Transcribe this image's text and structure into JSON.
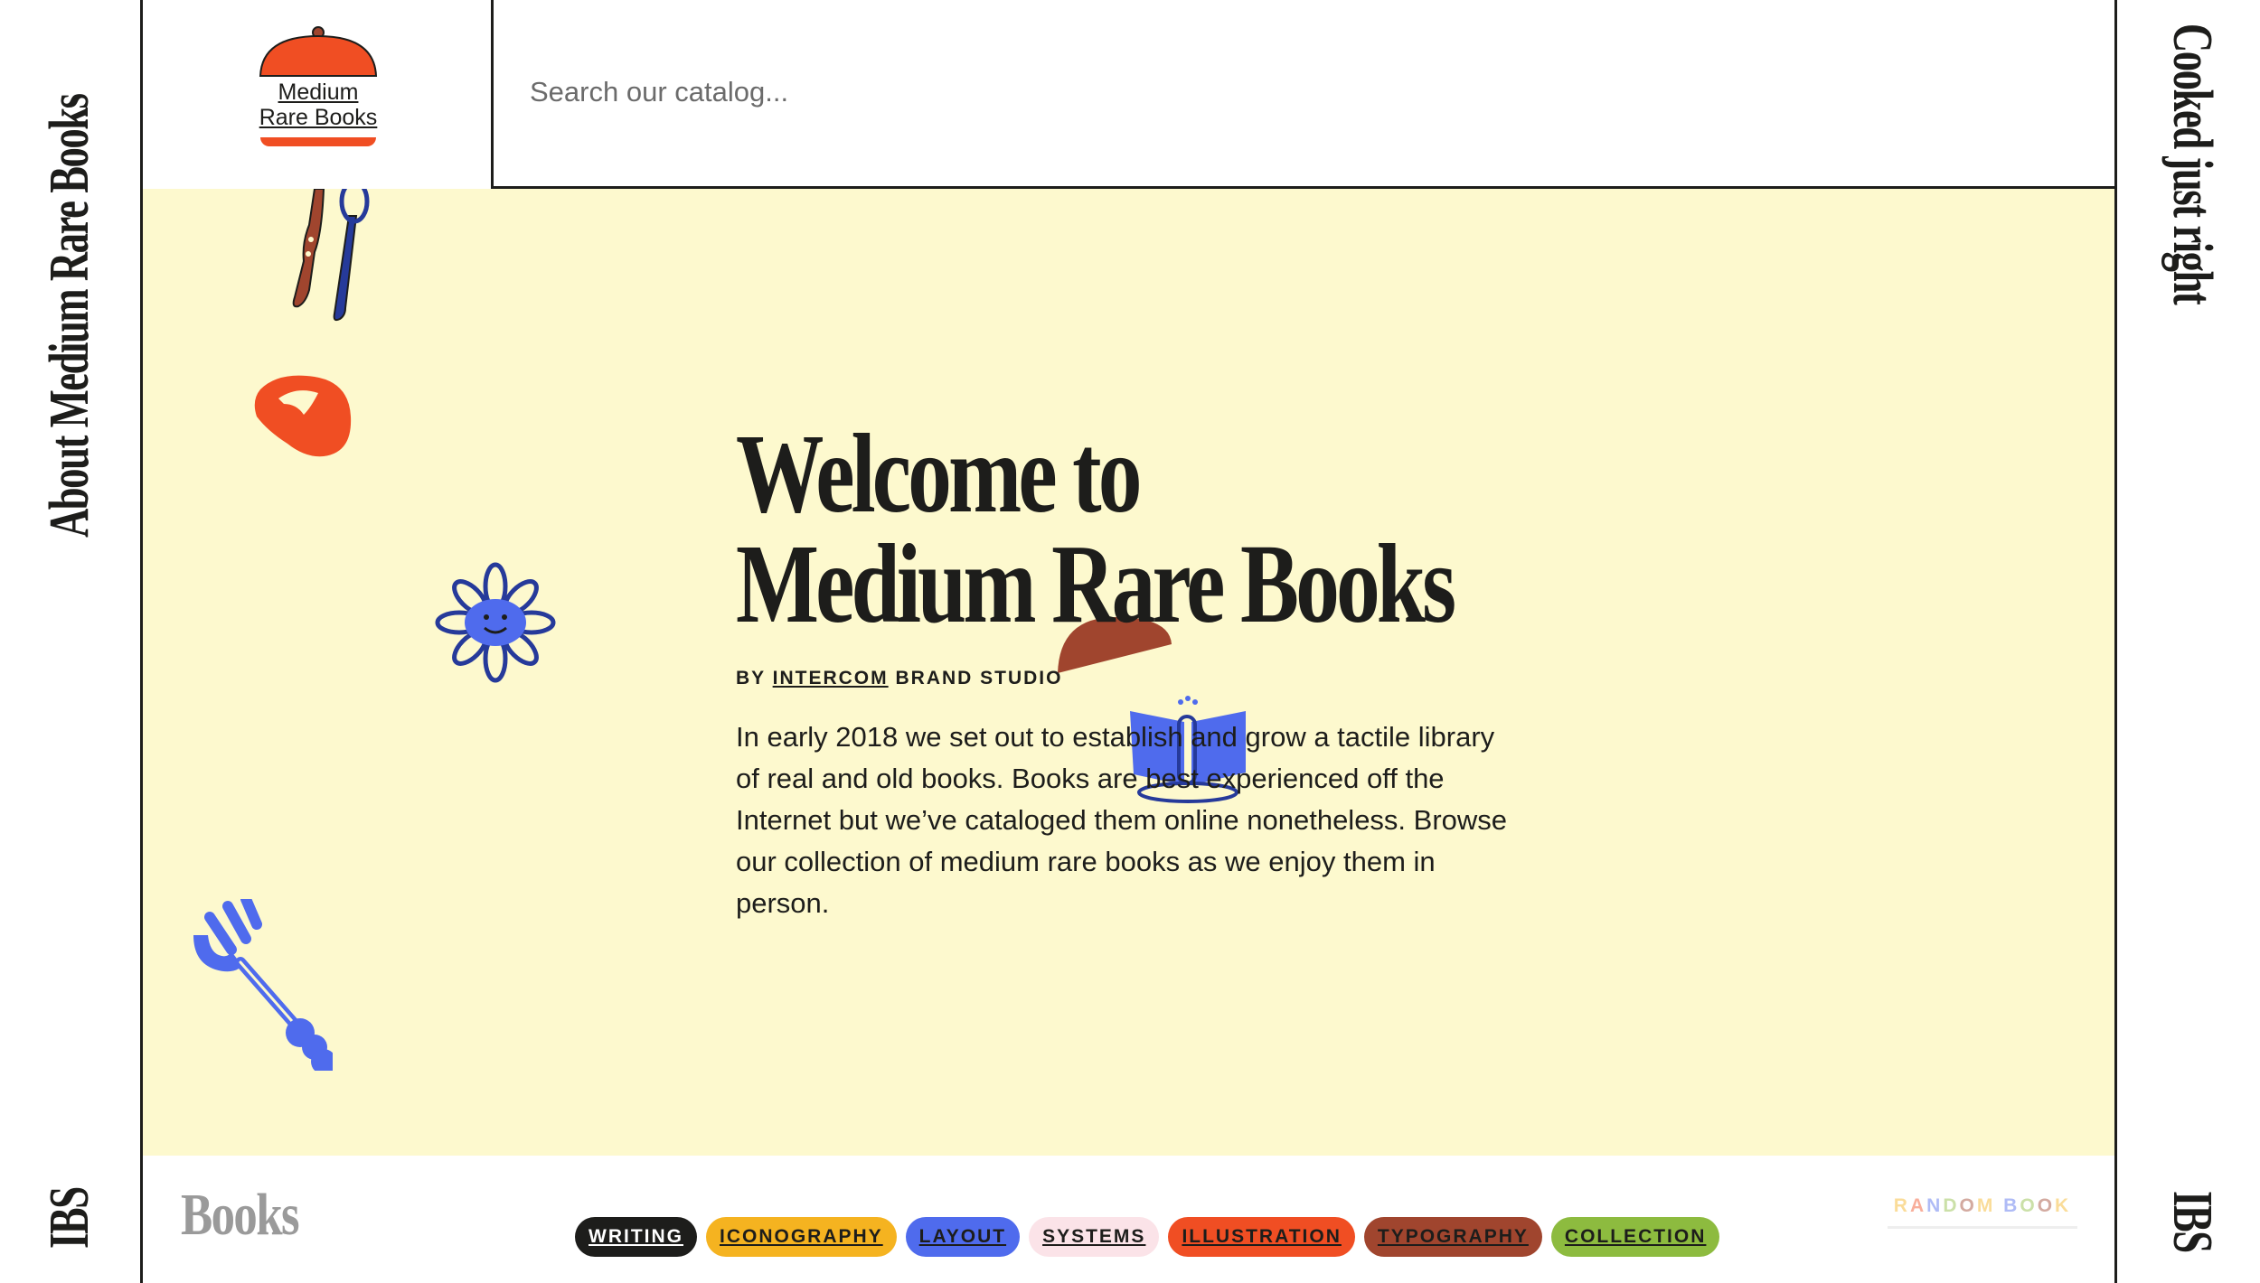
{
  "left_rail": {
    "about_label": "About Medium Rare Books",
    "ibs_label": "IBS"
  },
  "right_rail": {
    "tagline": "Cooked just right",
    "ibs_label": "IBS"
  },
  "logo": {
    "line1": "Medium",
    "line2": "Rare Books"
  },
  "search": {
    "placeholder": "Search our catalog..."
  },
  "hero": {
    "title_line1": "Welcome to",
    "title_line2": "Medium Rare Books",
    "byline_prefix": "BY",
    "byline_link": "INTERCOM",
    "byline_suffix": "BRAND STUDIO",
    "intro": "In early 2018 we set out to establish and grow a tactile library of real and old books. Books are best experienced off the Internet but we’ve cataloged them online nonetheless. Browse our collection of medium rare books as we enjoy them in person."
  },
  "footer": {
    "books_label": "Books",
    "categories": [
      {
        "label": "WRITING",
        "bg": "#1d1d1b",
        "fg": "#ffffff"
      },
      {
        "label": "ICONOGRAPHY",
        "bg": "#f5b320",
        "fg": "#1d1d1b"
      },
      {
        "label": "LAYOUT",
        "bg": "#4f6bed",
        "fg": "#1d1d1b"
      },
      {
        "label": "SYSTEMS",
        "bg": "#fbe3e8",
        "fg": "#1d1d1b"
      },
      {
        "label": "ILLUSTRATION",
        "bg": "#f04e23",
        "fg": "#1d1d1b"
      },
      {
        "label": "TYPOGRAPHY",
        "bg": "#a0452e",
        "fg": "#1d1d1b"
      },
      {
        "label": "COLLECTION",
        "bg": "#8dbb3f",
        "fg": "#1d1d1b"
      }
    ],
    "random_label": "RANDOM BOOK"
  },
  "colors": {
    "hero_bg": "#fdf9ce",
    "accent_orange": "#f04e23",
    "accent_blue": "#4f6bed",
    "accent_brown": "#a0452e"
  },
  "icons": [
    "cloche-logo-icon",
    "knife-spoon-icon",
    "steak-icon",
    "flower-icon",
    "fork-icon",
    "half-sun-icon",
    "book-reader-icon"
  ]
}
